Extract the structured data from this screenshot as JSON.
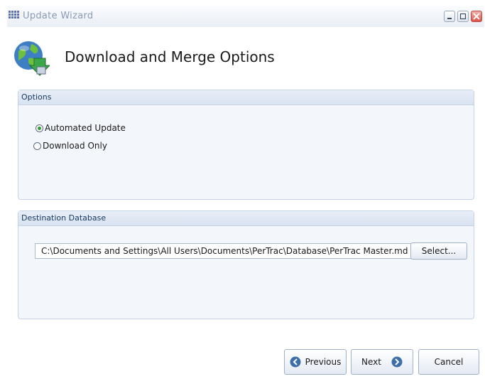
{
  "window": {
    "title": "Update Wizard"
  },
  "header": {
    "title": "Download and Merge Options"
  },
  "options": {
    "group_label": "Options",
    "choices": [
      {
        "label": "Automated Update",
        "checked": true
      },
      {
        "label": "Download Only",
        "checked": false
      }
    ]
  },
  "destination": {
    "group_label": "Destination Database",
    "path_value": "C:\\Documents and Settings\\All Users\\Documents\\PerTrac\\Database\\PerTrac Master.md",
    "select_label": "Select..."
  },
  "footer": {
    "previous_label": "Previous",
    "next_label": "Next",
    "cancel_label": "Cancel"
  },
  "icons": {
    "app": "grid-icon",
    "header": "globe-download-icon",
    "previous": "arrow-left-circle-icon",
    "next": "arrow-right-circle-icon"
  }
}
